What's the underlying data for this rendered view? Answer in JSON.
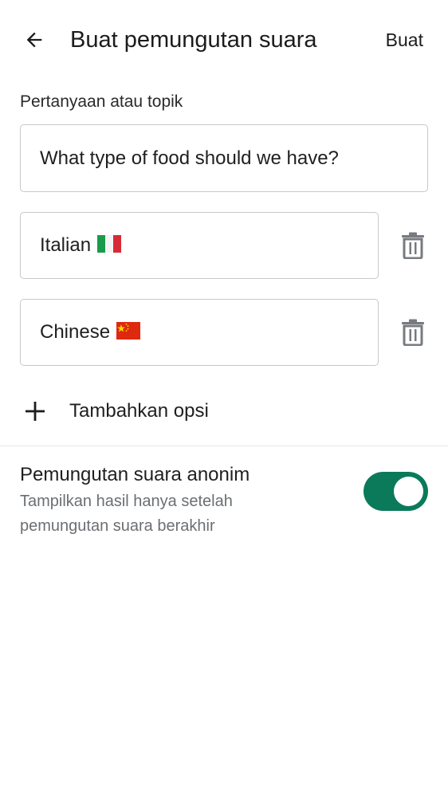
{
  "header": {
    "title": "Buat pemungutan suara",
    "create_label": "Buat",
    "back_icon": "arrow-back-icon"
  },
  "form": {
    "question_label": "Pertanyaan atau topik",
    "question_value": "What type of food should we have?",
    "options": [
      {
        "value": "Italian",
        "flag": "italy-flag-icon"
      },
      {
        "value": "Chinese",
        "flag": "china-flag-icon"
      }
    ],
    "delete_icon": "trash-icon",
    "add_option_label": "Tambahkan opsi",
    "add_icon": "plus-icon"
  },
  "anonymous": {
    "title": "Pemungutan suara anonim",
    "subtitle": "Tampilkan hasil hanya setelah pemungutan suara berakhir",
    "enabled": true
  },
  "colors": {
    "accent": "#0b7a5a",
    "text_primary": "#1f1f1f",
    "text_secondary": "#6b6f73",
    "border": "#c8c8c8"
  }
}
